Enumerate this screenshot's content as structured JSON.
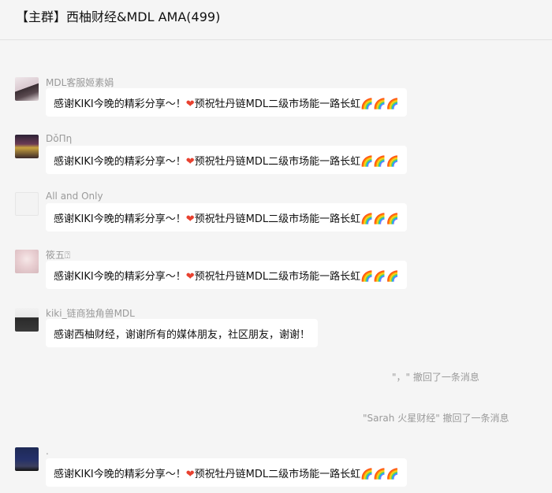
{
  "header": {
    "title": "【主群】西柚财经&MDL AMA(499)"
  },
  "messages": [
    {
      "sender": "MDL客服姬素娟",
      "text": "感谢KIKI今晚的精彩分享～！",
      "heart": "❤",
      "text2": "预祝牡丹链MDL二级市场能一路长虹",
      "rainbows": "🌈🌈🌈"
    },
    {
      "sender": "DǒΠη",
      "text": "感谢KIKI今晚的精彩分享～！",
      "heart": "❤",
      "text2": "预祝牡丹链MDL二级市场能一路长虹",
      "rainbows": "🌈🌈🌈"
    },
    {
      "sender": "All and Only",
      "text": "感谢KIKI今晚的精彩分享～！",
      "heart": "❤",
      "text2": "预祝牡丹链MDL二级市场能一路长虹",
      "rainbows": "🌈🌈🌈"
    },
    {
      "sender": "筱五⍰",
      "text": "感谢KIKI今晚的精彩分享～！",
      "heart": "❤",
      "text2": "预祝牡丹链MDL二级市场能一路长虹",
      "rainbows": "🌈🌈🌈"
    },
    {
      "sender": "kiki_链商独角兽MDL",
      "text": "感谢西柚财经，谢谢所有的媒体朋友，社区朋友，谢谢！"
    },
    {
      "sender": ".",
      "text": "感谢KIKI今晚的精彩分享～！",
      "heart": "❤",
      "text2": "预祝牡丹链MDL二级市场能一路长虹",
      "rainbows": "🌈🌈🌈"
    }
  ],
  "recalls": [
    {
      "text": "\"，\" 撤回了一条消息"
    },
    {
      "text": "\"Sarah 火星财经\" 撤回了一条消息"
    }
  ],
  "colors": {
    "background": "#f5f5f5",
    "bubble": "#ffffff",
    "meta_text": "#9a9a9a",
    "heart": "#e8412f"
  },
  "icons": {
    "avatar": "avatar-image"
  }
}
